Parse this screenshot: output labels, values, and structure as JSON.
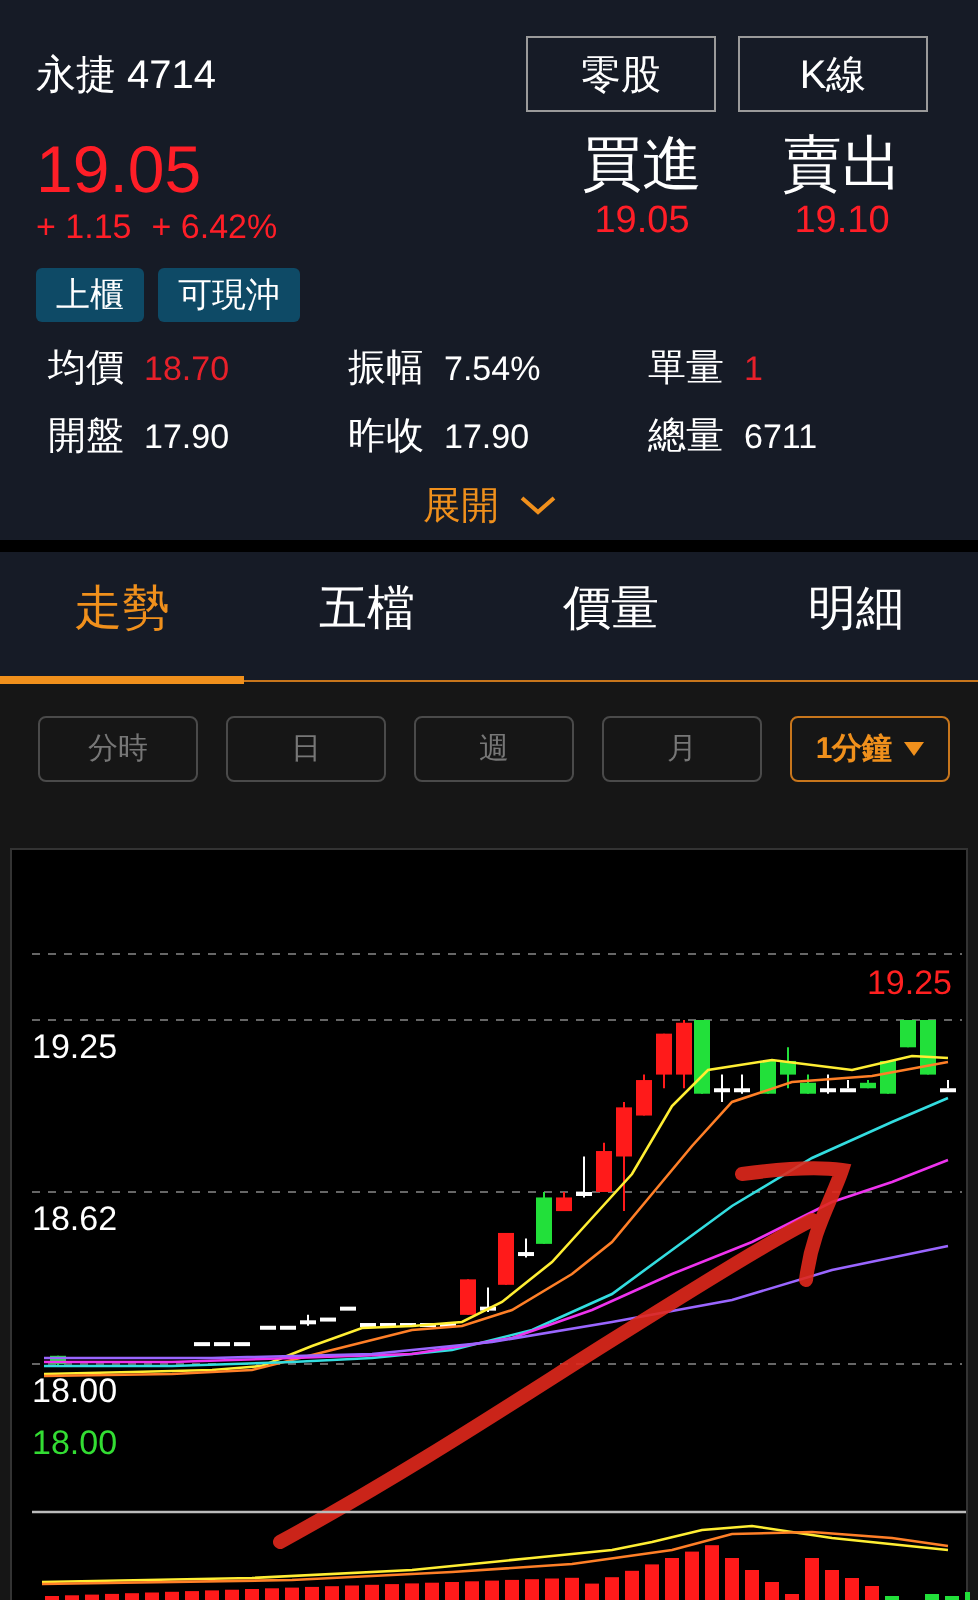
{
  "stock": {
    "name": "永捷",
    "code": "4714",
    "price": "19.05",
    "change": "+ 1.15",
    "change_pct": "+ 6.42%"
  },
  "header_buttons": [
    "零股",
    "K線"
  ],
  "quotes": [
    {
      "label": "買進",
      "value": "19.05"
    },
    {
      "label": "賣出",
      "value": "19.10"
    }
  ],
  "tags": [
    "上櫃",
    "可現沖"
  ],
  "stats": [
    {
      "label": "均價",
      "value": "18.70",
      "color": "#e8202a"
    },
    {
      "label": "振幅",
      "value": "7.54%",
      "color": "#ffffff"
    },
    {
      "label": "單量",
      "value": "1",
      "color": "#e8202a"
    },
    {
      "label": "開盤",
      "value": "17.90",
      "color": "#ffffff"
    },
    {
      "label": "昨收",
      "value": "17.90",
      "color": "#ffffff"
    },
    {
      "label": "總量",
      "value": "6711",
      "color": "#ffffff"
    }
  ],
  "expand": {
    "label": "展開",
    "expanded": false
  },
  "tabs": [
    {
      "label": "走勢",
      "selected": true
    },
    {
      "label": "五檔",
      "selected": false
    },
    {
      "label": "價量",
      "selected": false
    },
    {
      "label": "明細",
      "selected": false
    }
  ],
  "periods": [
    {
      "label": "分時",
      "selected": false,
      "kind": "button"
    },
    {
      "label": "日",
      "selected": false,
      "kind": "button"
    },
    {
      "label": "週",
      "selected": false,
      "kind": "button"
    },
    {
      "label": "月",
      "selected": false,
      "kind": "button"
    },
    {
      "label": "1分鐘",
      "selected": true,
      "kind": "dropdown"
    }
  ],
  "chart": {
    "labels": [
      {
        "text": "19.25",
        "kind": "high"
      },
      {
        "text": "19.25",
        "kind": "axis"
      },
      {
        "text": "18.62",
        "kind": "axis"
      },
      {
        "text": "18.00",
        "kind": "axis"
      },
      {
        "text": "18.00",
        "kind": "low"
      }
    ]
  }
}
